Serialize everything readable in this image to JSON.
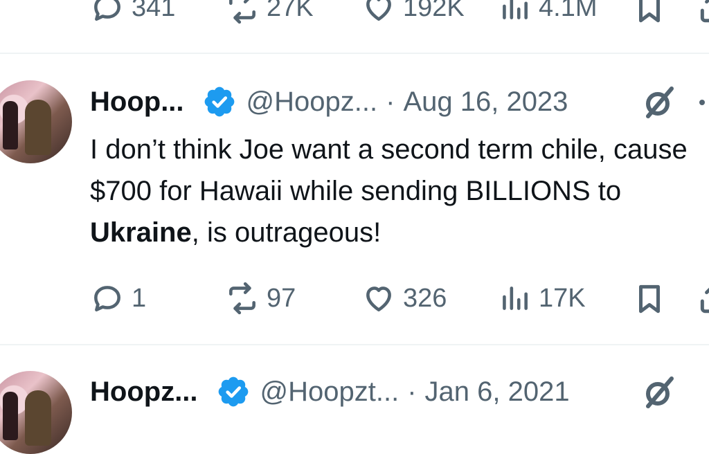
{
  "top_tweet": {
    "replies": "341",
    "reposts": "27K",
    "likes": "192K",
    "views": "4.1M"
  },
  "tweet": {
    "name": "Hoop...",
    "handle": "@Hoopz...",
    "separator": "·",
    "date": "Aug 16, 2023",
    "text_part1": "I don’t think Joe want a second term chile, cause $700 for Hawaii while sending BILLIONS to ",
    "text_bold": "Ukraine",
    "text_part2": ", is outrageous!",
    "replies": "1",
    "reposts": "97",
    "likes": "326",
    "views": "17K"
  },
  "next_tweet": {
    "name": "Hoopz...",
    "handle": "@Hoopzt...",
    "separator": "·",
    "date": "Jan 6, 2021"
  },
  "colors": {
    "verified_blue": "#1d9bf0",
    "muted": "#536471",
    "divider": "#eff3f4"
  },
  "icons": [
    "reply-icon",
    "repost-icon",
    "like-icon",
    "views-icon",
    "bookmark-icon",
    "share-icon",
    "grok-icon",
    "verified-icon",
    "more-icon"
  ]
}
